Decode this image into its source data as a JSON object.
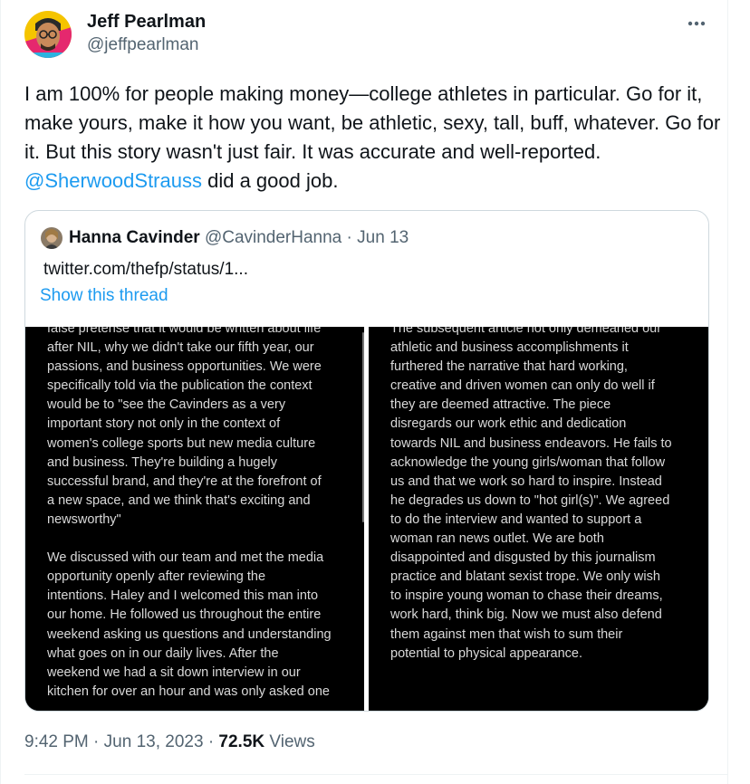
{
  "author": {
    "name": "Jeff Pearlman",
    "handle": "@jeffpearlman"
  },
  "tweet": {
    "text_before_mention": "I am 100% for people making money—college athletes in particular. Go for it, make yours, make it how you want, be athletic, sexy, tall, buff, whatever. Go for it. But this story wasn't just fair. It was accurate and well-reported. ",
    "mention": "@SherwoodStrauss",
    "text_after_mention": " did a good job."
  },
  "quoted": {
    "name": "Hanna Cavinder",
    "handle": "@CavinderHanna",
    "separator": "·",
    "date": "Jun 13",
    "link_text": "twitter.com/thefp/status/1...",
    "show_thread": "Show this thread",
    "image_left_text": "false pretense that it would be written about life\nafter NIL, why we didn't take our fifth year, our\npassions, and business opportunities. We were\nspecifically told via the publication the context\nwould be to \"see the Cavinders as a very\nimportant story not only in the context of\nwomen's college sports but new media culture\nand business. They're building a hugely\nsuccessful brand, and they're at the forefront of\na new space, and we think that's exciting and\nnewsworthy\"\n\nWe discussed with our team and met the media\nopportunity openly after reviewing the\nintentions. Haley and I welcomed this man into\nour home. He followed us throughout the entire\nweekend asking us questions and understanding\nwhat goes on in our daily lives. After the\nweekend we had a sit down interview in our\nkitchen for over an hour and was only asked one",
    "image_right_text": "The subsequent article not only demeaned our\nathletic and business accomplishments it\nfurthered the narrative that hard working,\ncreative and driven women can only do well if\nthey are deemed attractive. The piece\ndisregards our work ethic and dedication\ntowards NIL and business endeavors. He fails to\nacknowledge the young girls/woman that follow\nus and that we work so hard to inspire. Instead\nhe degrades us down to \"hot girl(s)\". We agreed\nto do the interview and wanted to support a\nwoman ran news outlet. We are both\ndisappointed and disgusted by this journalism\npractice and blatant sexist trope. We only wish\nto inspire young woman to chase their dreams,\nwork hard, think big. Now we must also defend\nthem against men that wish to sum their\npotential to physical appearance."
  },
  "footer": {
    "time": "9:42 PM",
    "sep": "·",
    "date": "Jun 13, 2023",
    "sep2": "·",
    "views_count": "72.5K",
    "views_label": "Views"
  },
  "icons": {
    "more": "more-horizontal-icon",
    "avatar": "cartoon-avatar",
    "quoted_avatar": "photo-avatar"
  },
  "colors": {
    "link": "#1d9bf0",
    "secondary": "#536471",
    "border": "#cfd9de"
  }
}
